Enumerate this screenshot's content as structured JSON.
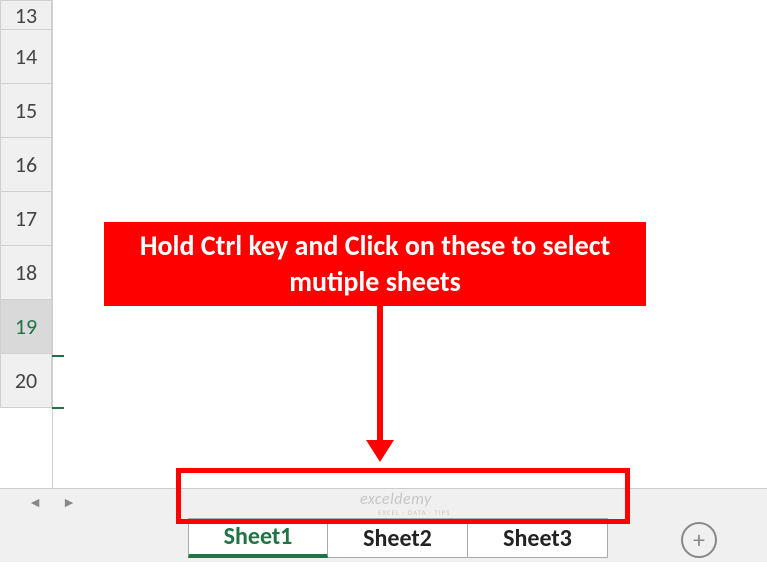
{
  "rows": {
    "r1": "13",
    "r2": "14",
    "r3": "15",
    "r4": "16",
    "r5": "17",
    "r6": "18",
    "r7": "19",
    "r8": "20"
  },
  "callout": {
    "text": "Hold Ctrl key and Click on these to select mutiple sheets"
  },
  "tabs": {
    "t1": "Sheet1",
    "t2": "Sheet2",
    "t3": "Sheet3"
  },
  "scroll": {
    "left": "◄",
    "right": "►"
  },
  "add": {
    "label": "+"
  },
  "watermark": {
    "main": "exceldemy",
    "sub": "EXCEL · DATA · TIPS"
  }
}
